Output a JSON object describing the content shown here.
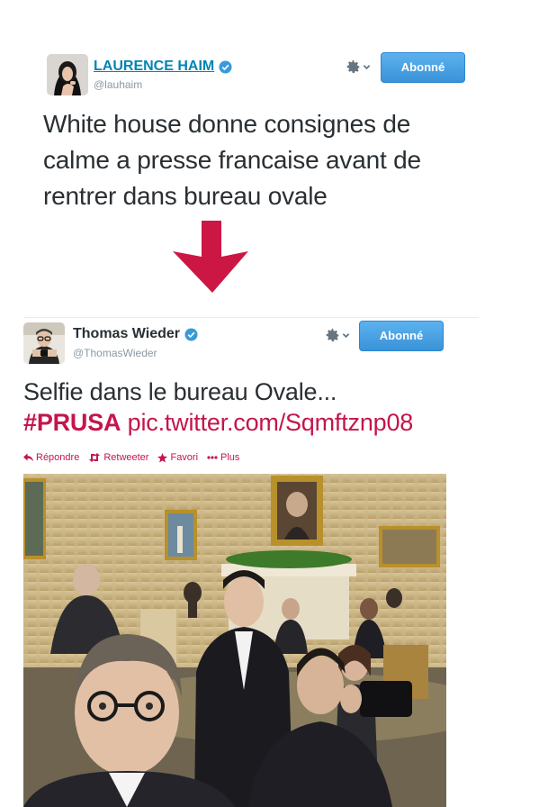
{
  "tweets": [
    {
      "display_name": "LAURENCE HAIM",
      "handle": "@lauhaim",
      "verified": true,
      "follow_label": "Abonné",
      "text": "White house donne consignes de calme a presse francaise avant de rentrer dans bureau ovale"
    },
    {
      "display_name": "Thomas Wieder",
      "handle": "@ThomasWieder",
      "verified": true,
      "follow_label": "Abonné",
      "text": "Selfie dans le bureau Ovale...",
      "hashtag": "#PRUSA",
      "link": "pic.twitter.com/Sqmftznp08",
      "actions": {
        "reply": "Répondre",
        "retweet": "Retweeter",
        "favorite": "Favori",
        "more": "Plus"
      }
    }
  ],
  "colors": {
    "accent": "#c4154c",
    "link_blue": "#0084b4",
    "follow_button": "#3a93d9",
    "arrow": "#cc1744",
    "verified": "#3a9ad9"
  },
  "icons": [
    "verified-badge-icon",
    "gear-icon",
    "chevron-down-icon",
    "reply-icon",
    "retweet-icon",
    "star-icon",
    "ellipsis-icon",
    "down-arrow"
  ]
}
